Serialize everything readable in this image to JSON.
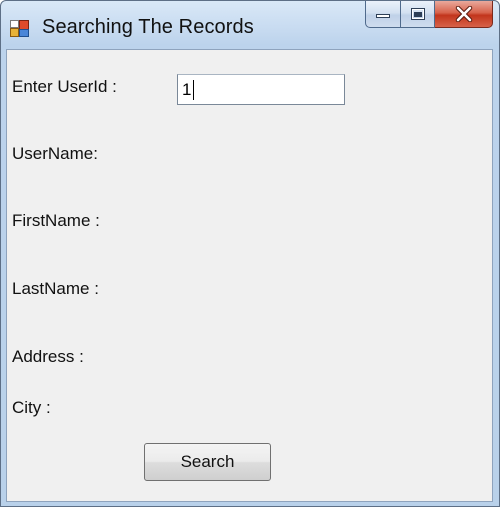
{
  "window": {
    "title": "Searching The Records"
  },
  "icons": {
    "app": "app-icon",
    "minimize": "minimize-icon",
    "maximize": "maximize-icon",
    "close": "close-icon"
  },
  "colors": {
    "titlebar": "#c6daf0",
    "client_background": "#f0f0f0",
    "close_button": "#c2351c"
  },
  "form": {
    "userid_label": "Enter UserId :",
    "userid_value": "1",
    "username_label": "UserName:",
    "firstname_label": "FirstName :",
    "lastname_label": "LastName :",
    "address_label": "Address :",
    "city_label": "City :",
    "search_button": "Search"
  }
}
